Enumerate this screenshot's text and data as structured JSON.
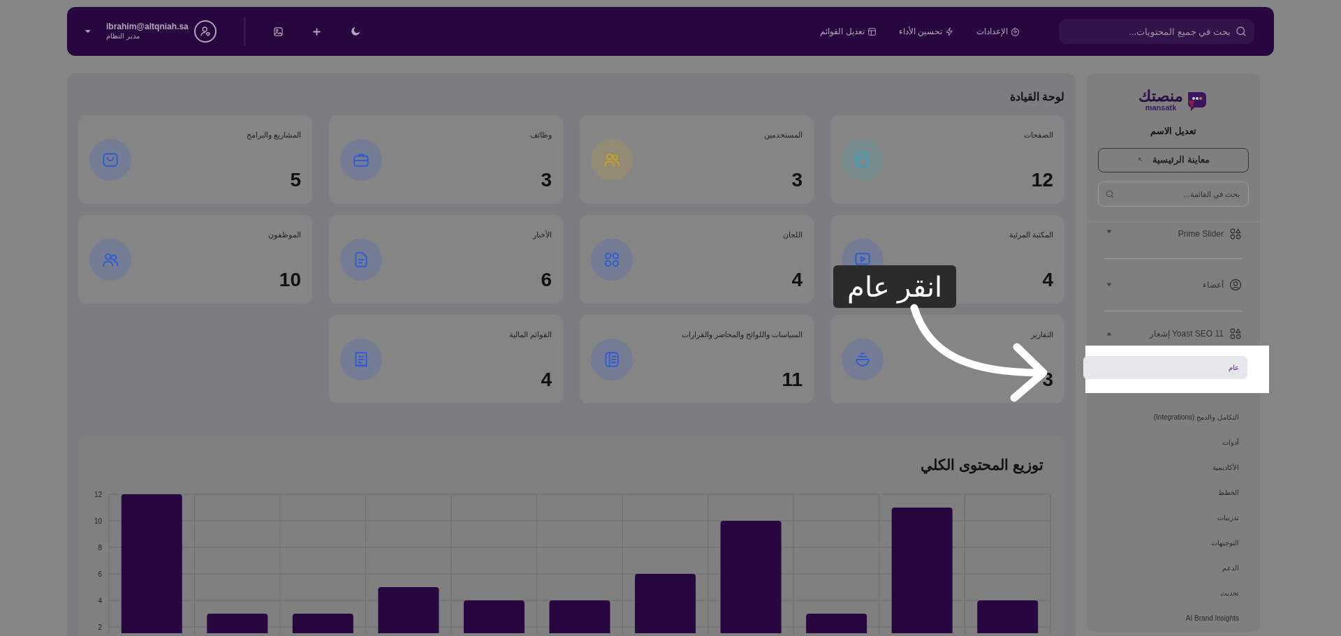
{
  "header": {
    "user": {
      "email": "ibrahim@altqniah.sa",
      "role": "مدير النظام"
    },
    "search": {
      "placeholder": "بحث في جميع المحتويات..."
    },
    "links": [
      {
        "label": "الإعدادات",
        "kind": "settings"
      },
      {
        "label": "تحسين الأداء",
        "kind": "bolt"
      },
      {
        "label": "تعديل القوائم",
        "kind": "layout"
      }
    ]
  },
  "sidebar": {
    "logo": {
      "name": "منصتك",
      "latin": "mansatk"
    },
    "title": "تعديل الاسم",
    "preview_button": "معاينة الرئيسية",
    "search": {
      "placeholder": "بحث في القائمة..."
    },
    "items": [
      {
        "label": "Prime Slider",
        "kind": "grid",
        "expanded": false
      },
      {
        "label": "أعضاء",
        "kind": "user",
        "expanded": false
      },
      {
        "label": "Yoast SEO 11 إشعار",
        "kind": "grid",
        "expanded": true,
        "children": [
          {
            "label": "عام",
            "selected": true
          },
          {
            "label": "التكامل والدمج (Integrations)",
            "selected": false
          },
          {
            "label": "أدوات",
            "selected": false
          },
          {
            "label": "الأكاديمية",
            "selected": false
          },
          {
            "label": "الخطط",
            "selected": false
          },
          {
            "label": "تدريبات",
            "selected": false
          },
          {
            "label": "التوجيهات",
            "selected": false
          },
          {
            "label": "الدعم",
            "selected": false
          },
          {
            "label": "تحديث",
            "selected": false
          },
          {
            "label": "AI Brand Insights",
            "selected": false
          }
        ]
      }
    ]
  },
  "dashboard": {
    "title": "لوحة القيادة",
    "cards": [
      {
        "label": "الصفحات",
        "value": "12",
        "kind": "notebook",
        "color": "#3aa0b5"
      },
      {
        "label": "المستخدمين",
        "value": "3",
        "kind": "users",
        "color": "#c9a227"
      },
      {
        "label": "وظائف",
        "value": "3",
        "kind": "briefcase",
        "color": "#2f5bd3"
      },
      {
        "label": "المشاريع والبرامج",
        "value": "5",
        "kind": "bag",
        "color": "#2f5bd3"
      },
      {
        "label": "المكتبة المرئية",
        "value": "4",
        "kind": "video",
        "color": "#2f5bd3"
      },
      {
        "label": "اللجان",
        "value": "4",
        "kind": "grid",
        "color": "#2f5bd3"
      },
      {
        "label": "الأخبار",
        "value": "6",
        "kind": "document",
        "color": "#2f5bd3"
      },
      {
        "label": "الموظفون",
        "value": "10",
        "kind": "users",
        "color": "#2f5bd3"
      },
      {
        "label": "التقارير",
        "value": "3",
        "kind": "bowl",
        "color": "#2f5bd3"
      },
      {
        "label": "السياسات واللوائح والمحاضر والقرارات",
        "value": "11",
        "kind": "book",
        "color": "#2f5bd3"
      },
      {
        "label": "القوائم المالية",
        "value": "4",
        "kind": "receipt",
        "color": "#2f5bd3"
      }
    ]
  },
  "chart": {
    "chart_data": {
      "type": "bar",
      "title": "توزيع المحتوى الكلي",
      "series": [
        {
          "color": "#280640",
          "values": [
            12,
            3,
            3,
            5,
            4,
            4,
            6,
            10,
            3,
            11,
            4
          ]
        }
      ],
      "ylim": [
        1.5,
        12
      ],
      "yticks": [
        2,
        4,
        6,
        8,
        10,
        12
      ],
      "grid": true
    }
  },
  "tutorial": {
    "hint": "انقر عام"
  }
}
